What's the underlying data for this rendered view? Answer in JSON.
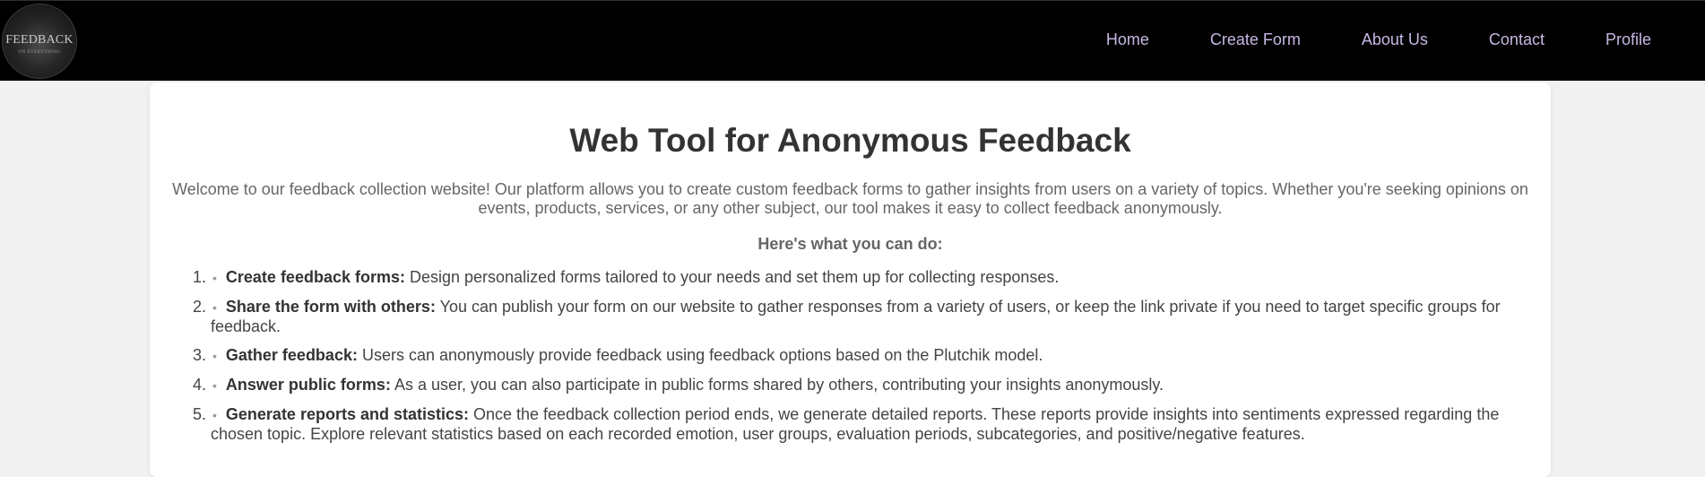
{
  "header": {
    "logo": {
      "main": "FEEDBACK",
      "sub": "ON EVERYTHING"
    },
    "nav": [
      {
        "label": "Home"
      },
      {
        "label": "Create Form"
      },
      {
        "label": "About Us"
      },
      {
        "label": "Contact"
      },
      {
        "label": "Profile"
      }
    ],
    "nav_color": "#c7b6e2"
  },
  "main": {
    "title": "Web Tool for Anonymous Feedback",
    "intro": "Welcome to our feedback collection website! Our platform allows you to create custom feedback forms to gather insights from users on a variety of topics. Whether you're seeking opinions on events, products, services, or any other subject, our tool makes it easy to collect feedback anonymously.",
    "subheading": "Here's what you can do:",
    "bullet": "•",
    "features": [
      {
        "name": "Create feedback forms:",
        "text": " Design personalized forms tailored to your needs and set them up for collecting responses."
      },
      {
        "name": "Share the form with others:",
        "text": " You can publish your form on our website to gather responses from a variety of users, or keep the link private if you need to target specific groups for feedback."
      },
      {
        "name": "Gather feedback:",
        "text": " Users can anonymously provide feedback using feedback options based on the Plutchik model."
      },
      {
        "name": "Answer public forms:",
        "text": " As a user, you can also participate in public forms shared by others, contributing your insights anonymously."
      },
      {
        "name": "Generate reports and statistics:",
        "text": " Once the feedback collection period ends, we generate detailed reports. These reports provide insights into sentiments expressed regarding the chosen topic. Explore relevant statistics based on each recorded emotion, user groups, evaluation periods, subcategories, and positive/negative features."
      }
    ]
  }
}
